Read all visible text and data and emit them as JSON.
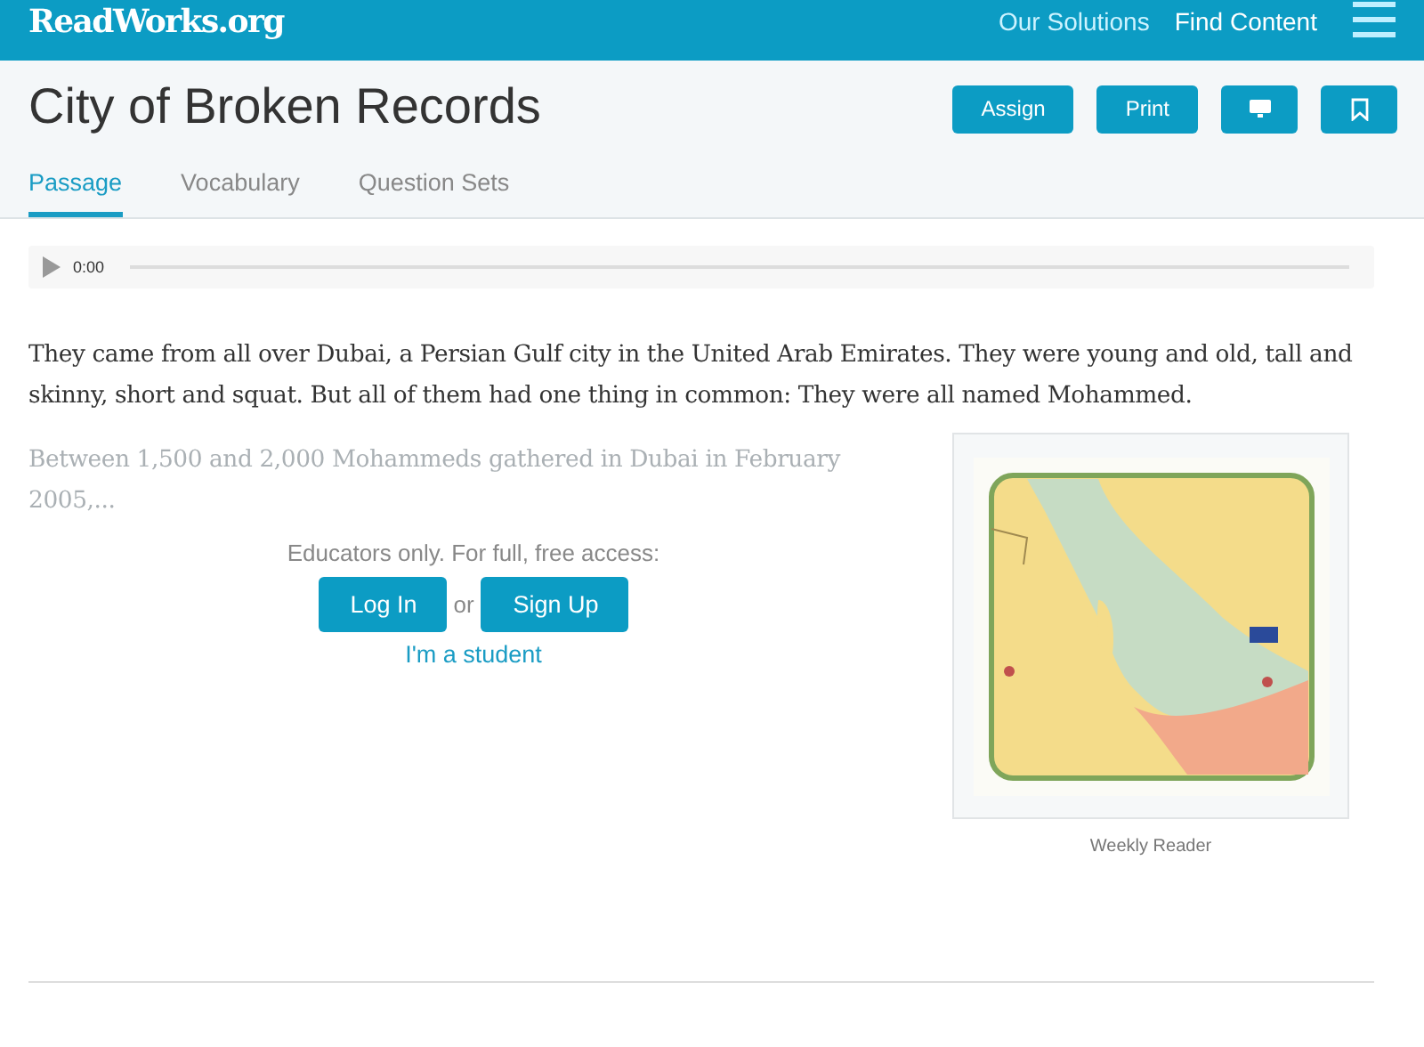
{
  "header": {
    "logo": "ReadWorks.org",
    "nav": [
      "Our Solutions",
      "Find Content"
    ]
  },
  "title": "City of Broken Records",
  "actions": [
    {
      "kind": "text",
      "label": "Assign"
    },
    {
      "kind": "text",
      "label": "Print"
    },
    {
      "kind": "projector"
    },
    {
      "kind": "bookmark"
    }
  ],
  "tabs": [
    {
      "label": "Passage",
      "selected": true
    },
    {
      "label": "Vocabulary",
      "selected": false
    },
    {
      "label": "Question Sets",
      "selected": false
    }
  ],
  "audio": {
    "time": "0:00"
  },
  "paragraphs": [
    "They came from all over Dubai, a Persian Gulf city in the United Arab Emirates. They were young and old, tall and skinny, short and squat. But all of them had one thing in common: They were all named Mohammed."
  ],
  "teaser": "Between 1,500 and 2,000 Mohammeds gathered in Dubai in February 2005,...",
  "gate": {
    "message": "Educators only. For full, free access:",
    "login": "Log In",
    "or": "or",
    "signup": "Sign Up",
    "student": "I'm a student"
  },
  "figure": {
    "kind": "picture",
    "caption": "Weekly Reader"
  }
}
